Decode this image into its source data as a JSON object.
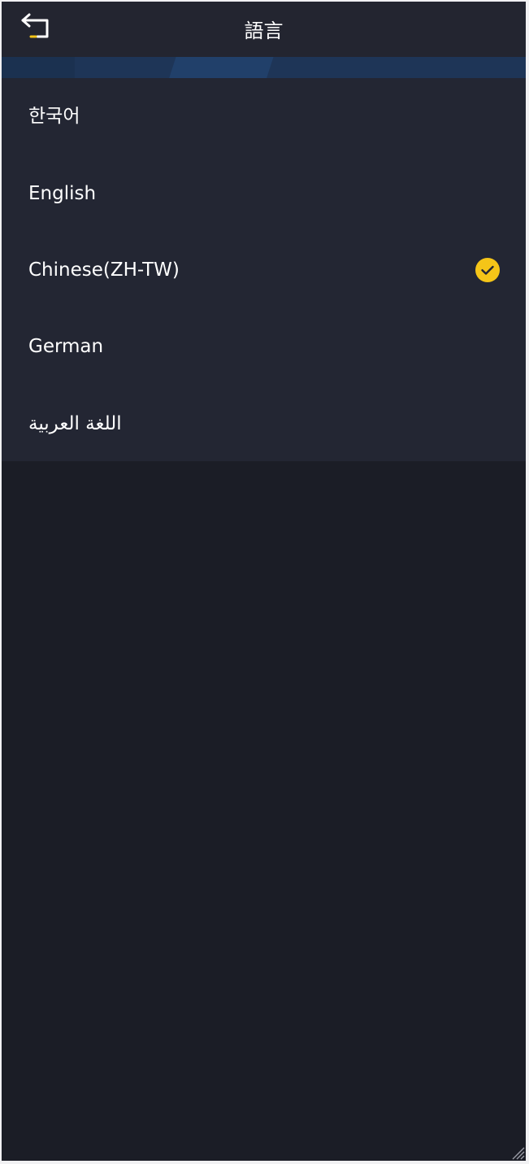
{
  "header": {
    "title": "語言",
    "back_icon": "back-arrow-icon"
  },
  "languages": [
    {
      "label": "한국어",
      "selected": false
    },
    {
      "label": "English",
      "selected": false
    },
    {
      "label": "Chinese(ZH-TW)",
      "selected": true
    },
    {
      "label": "German",
      "selected": false
    },
    {
      "label": "اللغة العربية",
      "selected": false
    }
  ],
  "colors": {
    "background": "#1b1d26",
    "header": "#232530",
    "panel": "#232633",
    "accent": "#f5c518",
    "text": "#ffffff"
  }
}
